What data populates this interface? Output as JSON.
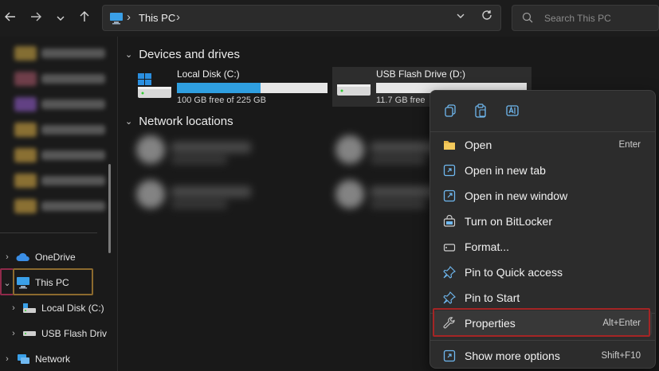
{
  "window": {
    "breadcrumb": "This PC",
    "search_placeholder": "Search This PC"
  },
  "sidebar": {
    "tree": [
      {
        "label": "OneDrive",
        "icon": "onedrive-icon",
        "expanded": false
      },
      {
        "label": "This PC",
        "icon": "computer-icon",
        "expanded": true
      },
      {
        "label": "Local Disk (C:)",
        "icon": "local-disk-icon",
        "expanded": false
      },
      {
        "label": "USB Flash Driv",
        "icon": "usb-drive-icon",
        "expanded": false
      },
      {
        "label": "Network",
        "icon": "network-icon",
        "expanded": false
      }
    ]
  },
  "main": {
    "groups": [
      {
        "label": "Devices and drives",
        "expanded": true
      },
      {
        "label": "Network locations",
        "expanded": true
      }
    ],
    "drives": [
      {
        "name": "Local Disk (C:)",
        "free": "100 GB free of 225 GB",
        "used_fraction": 0.556,
        "bar_color": "#2f9fe0",
        "selected": false
      },
      {
        "name": "USB Flash Drive (D:)",
        "free": "11.7 GB free",
        "used_fraction": 0.0,
        "bar_color": "#2f9fe0",
        "selected": true
      }
    ]
  },
  "context_menu": {
    "quick_actions": [
      "copy-icon",
      "paste-icon",
      "rename-icon"
    ],
    "items": [
      {
        "label": "Open",
        "shortcut": "Enter",
        "icon": "folder-icon"
      },
      {
        "label": "Open in new tab",
        "shortcut": "",
        "icon": "new-tab-icon"
      },
      {
        "label": "Open in new window",
        "shortcut": "",
        "icon": "new-window-icon"
      },
      {
        "label": "Turn on BitLocker",
        "shortcut": "",
        "icon": "bitlocker-icon"
      },
      {
        "label": "Format...",
        "shortcut": "",
        "icon": "format-icon"
      },
      {
        "label": "Pin to Quick access",
        "shortcut": "",
        "icon": "pin-icon"
      },
      {
        "label": "Pin to Start",
        "shortcut": "",
        "icon": "pin-start-icon"
      },
      {
        "label": "Properties",
        "shortcut": "Alt+Enter",
        "icon": "wrench-icon"
      },
      {
        "label": "Show more options",
        "shortcut": "Shift+F10",
        "icon": "more-options-icon"
      }
    ]
  },
  "colors": {
    "accent": "#2f9fe0",
    "highlight_border": "#a52525"
  }
}
